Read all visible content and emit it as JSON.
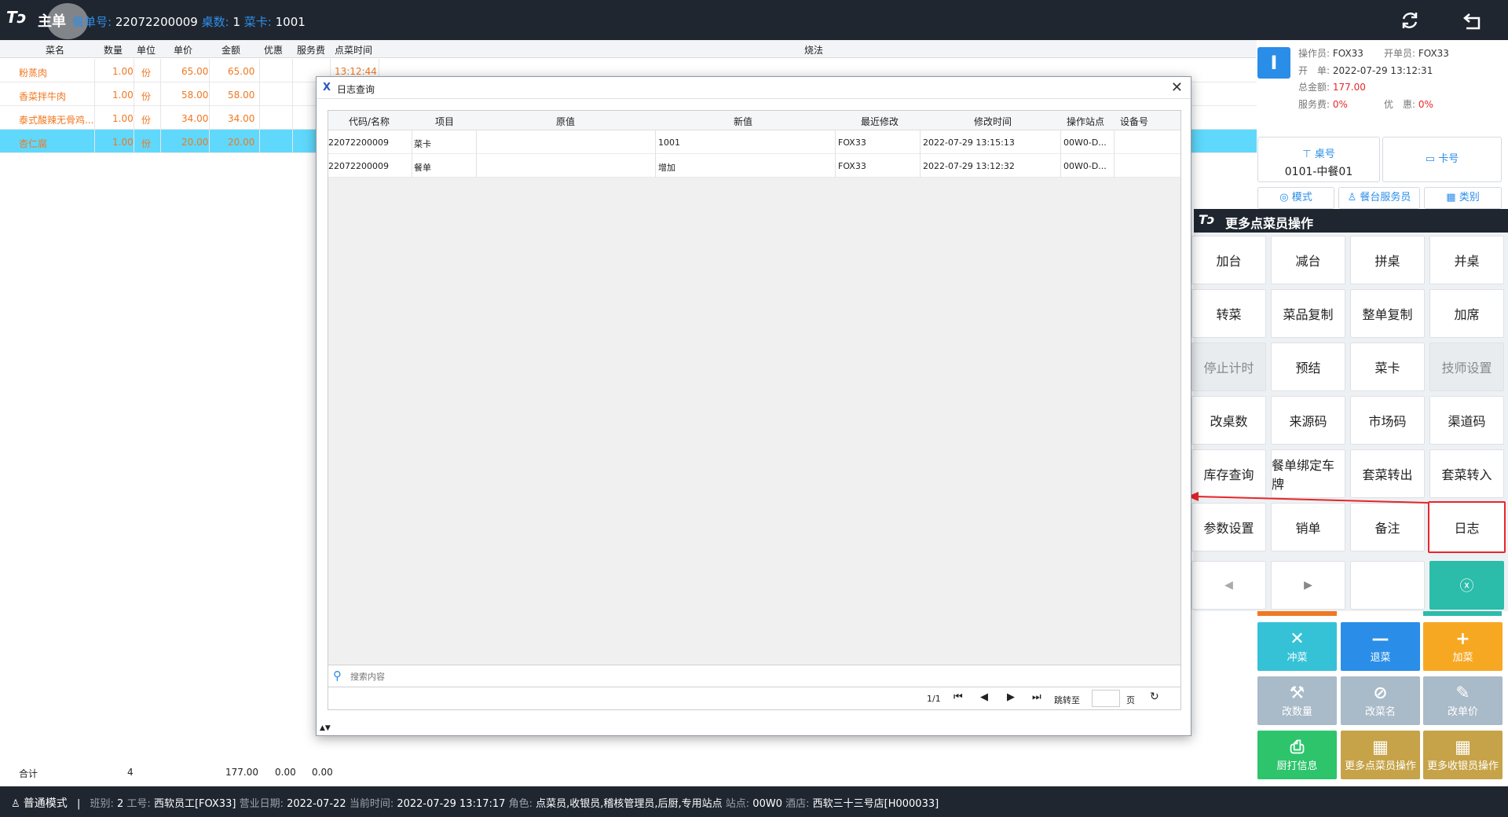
{
  "header": {
    "title": "主单",
    "order_no_label": "餐单号:",
    "order_no": "22072200009",
    "table_count_label": "桌数:",
    "table_count": "1",
    "card_label": "菜卡:",
    "card": "1001",
    "refresh_icon": "refresh-icon",
    "back_icon": "back-icon"
  },
  "order_table": {
    "columns": [
      "菜名",
      "数量",
      "单位",
      "单价",
      "金额",
      "优惠",
      "服务费",
      "点菜时间",
      "烧法"
    ],
    "rows": [
      {
        "name": "粉蒸肉",
        "qty": "1.00",
        "unit": "份",
        "price": "65.00",
        "amount": "65.00",
        "time": "13:12:44"
      },
      {
        "name": "香菜拌牛肉",
        "qty": "1.00",
        "unit": "份",
        "price": "58.00",
        "amount": "58.00",
        "time": ""
      },
      {
        "name": "泰式酸辣无骨鸡...",
        "qty": "1.00",
        "unit": "份",
        "price": "34.00",
        "amount": "34.00",
        "time": ""
      },
      {
        "name": "杏仁腐",
        "qty": "1.00",
        "unit": "份",
        "price": "20.00",
        "amount": "20.00",
        "time": ""
      }
    ],
    "totals": {
      "label": "合计",
      "qty": "4",
      "amount": "177.00",
      "discount": "0.00",
      "service": "0.00"
    }
  },
  "info_panel": {
    "badge": "I",
    "operator_label": "操作员:",
    "operator": "FOX33",
    "opener_label": "开单员:",
    "opener": "FOX33",
    "open_label": "开　单:",
    "open_time": "2022-07-29 13:12:31",
    "total_label": "总金额:",
    "total": "177.00",
    "service_label": "服务费:",
    "service": "0%",
    "discount_label": "优　惠:",
    "discount": "0%",
    "table_btn_label": "桌号",
    "table_btn_value": "0101-中餐01",
    "card_btn_label": "卡号",
    "mode_label": "模式",
    "waiter_label": "餐台服务员",
    "category_label": "类别"
  },
  "more_ops": {
    "title": "更多点菜员操作",
    "buttons": [
      "加台",
      "减台",
      "拼桌",
      "并桌",
      "转菜",
      "菜品复制",
      "整单复制",
      "加席",
      "停止计时",
      "预结",
      "菜卡",
      "技师设置",
      "改桌数",
      "来源码",
      "市场码",
      "渠道码",
      "库存查询",
      "餐单绑定车牌",
      "套菜转出",
      "套菜转入",
      "参数设置",
      "销单",
      "备注",
      "日志"
    ]
  },
  "actions": {
    "wash": "冲菜",
    "return": "退菜",
    "add": "加菜",
    "change_qty": "改数量",
    "change_name": "改菜名",
    "change_price": "改单价",
    "kitchen_print": "厨打信息",
    "more_order_ops": "更多点菜员操作",
    "more_cashier_ops": "更多收银员操作"
  },
  "status_bar": {
    "mode": "普通模式",
    "shift_label": "班别:",
    "shift": "2",
    "staff_label": "工号:",
    "staff": "西软员工[FOX33]",
    "biz_date_label": "营业日期:",
    "biz_date": "2022-07-22",
    "cur_time_label": "当前时间:",
    "cur_time": "2022-07-29 13:17:17",
    "role_label": "角色:",
    "role": "点菜员,收银员,稽核管理员,后厨,专用站点",
    "station_label": "站点:",
    "station": "00W0",
    "hotel_label": "酒店:",
    "hotel": "西软三十三号店[H000033]"
  },
  "dialog": {
    "title": "日志查询",
    "columns": [
      "代码/名称",
      "项目",
      "原值",
      "新值",
      "最近修改",
      "修改时间",
      "操作站点",
      "设备号"
    ],
    "rows": [
      {
        "code": "22072200009",
        "item": "菜卡",
        "old": "",
        "new": "1001",
        "modifier": "FOX33",
        "time": "2022-07-29 13:15:13",
        "station": "00W0-D...",
        "device": ""
      },
      {
        "code": "22072200009",
        "item": "餐单",
        "old": "",
        "new": "增加",
        "modifier": "FOX33",
        "time": "2022-07-29 13:12:32",
        "station": "00W0-D...",
        "device": ""
      }
    ],
    "search_placeholder": "搜索内容",
    "page_info": "1/1",
    "jump_label": "跳转至",
    "page_unit": "页"
  }
}
